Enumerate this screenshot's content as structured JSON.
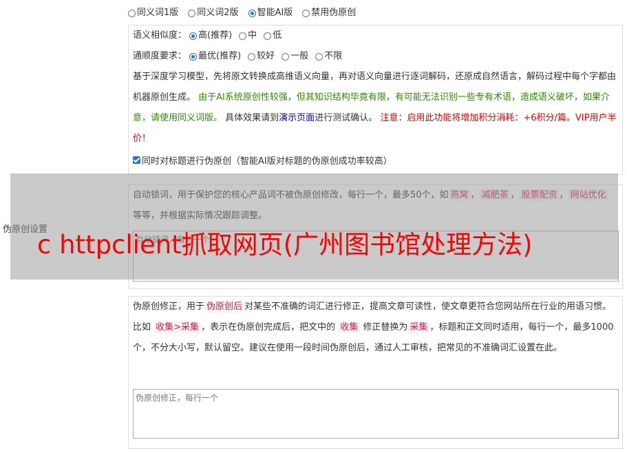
{
  "mode_options": [
    {
      "label": "同义词1版",
      "selected": false
    },
    {
      "label": "同义词2版",
      "selected": false
    },
    {
      "label": "智能AI版",
      "selected": true
    },
    {
      "label": "禁用伪原创",
      "selected": false
    }
  ],
  "similarity": {
    "label": "语义相似度：",
    "options": [
      {
        "label": "高(推荐)",
        "selected": true
      },
      {
        "label": "中",
        "selected": false
      },
      {
        "label": "低",
        "selected": false
      }
    ]
  },
  "fluency": {
    "label": "通顺度要求：",
    "options": [
      {
        "label": "最优(推荐)",
        "selected": true
      },
      {
        "label": "较好",
        "selected": false
      },
      {
        "label": "一般",
        "selected": false
      },
      {
        "label": "不限",
        "selected": false
      }
    ]
  },
  "desc": {
    "p1": "基于深度学习模型，先将原文转换成高维语义向量，再对语义向量进行逐词解码，还原成自然语言，解码过程中每个字都由机器原创生成。",
    "green": "由于AI系统原创性较强，但其知识结构毕竟有限，有可能无法识别一些专有术语，造成语义破坏，如果介意，请使用同义词版。",
    "p2": "具体效果请到",
    "link": "演示页面",
    "p3": "进行测试确认。",
    "red": "注意：启用此功能将增加积分消耗：+6积分/篇。VIP用户半价！"
  },
  "title_check": {
    "label": "同时对标题进行伪原创（智能AI版对标题的伪原创成功率较高）",
    "checked": true
  },
  "lock": {
    "t1": "自动锁词，用于保护您的核心产品词不被伪原创修改，每行一个，最多50个，如",
    "tags": [
      "燕窝",
      "减肥茶",
      "股票配资",
      "网站优化"
    ],
    "t2": "等等，并根据实际情况跟踪调整。",
    "placeholder": "自动锁词，每行一个"
  },
  "fix": {
    "t1": "伪原创修正，用于",
    "tag1": "伪原创后",
    "t2": "对某些不准确的词汇进行修正，提高文章可读性，使文章更符合您网站所在行业的用语习惯。比如",
    "tag2": "收集>采集",
    "t3": "，表示在伪原创完成后，把文中的",
    "tag3": "收集",
    "t4": "修正替换为",
    "tag4": "采集",
    "t5": "，标题和正文同时适用，每行一个，最多1000个，不分大小写，默认留空。建议在使用一段时间伪原创后，通过人工审核，把常见的不准确词汇设置在此。",
    "placeholder": "伪原创修正，每行一个"
  },
  "side_label": "伪原创设置",
  "overlay_title": "c httpclient抓取网页(广州图书馆处理方法)"
}
